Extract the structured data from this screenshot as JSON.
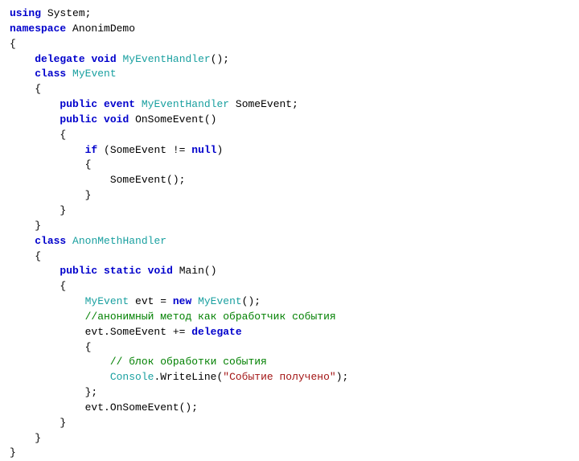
{
  "code": {
    "tokens": [
      [
        {
          "t": "using",
          "c": "kw"
        },
        {
          "t": " System;",
          "c": "p"
        }
      ],
      [
        {
          "t": "namespace",
          "c": "kw"
        },
        {
          "t": " AnonimDemo",
          "c": "p"
        }
      ],
      [
        {
          "t": "{",
          "c": "p"
        }
      ],
      [
        {
          "t": "    ",
          "c": "p"
        },
        {
          "t": "delegate",
          "c": "kw"
        },
        {
          "t": " ",
          "c": "p"
        },
        {
          "t": "void",
          "c": "kw"
        },
        {
          "t": " ",
          "c": "p"
        },
        {
          "t": "MyEventHandler",
          "c": "typ"
        },
        {
          "t": "();",
          "c": "p"
        }
      ],
      [
        {
          "t": "    ",
          "c": "p"
        },
        {
          "t": "class",
          "c": "kw"
        },
        {
          "t": " ",
          "c": "p"
        },
        {
          "t": "MyEvent",
          "c": "typ"
        }
      ],
      [
        {
          "t": "    {",
          "c": "p"
        }
      ],
      [
        {
          "t": "        ",
          "c": "p"
        },
        {
          "t": "public",
          "c": "kw"
        },
        {
          "t": " ",
          "c": "p"
        },
        {
          "t": "event",
          "c": "kw"
        },
        {
          "t": " ",
          "c": "p"
        },
        {
          "t": "MyEventHandler",
          "c": "typ"
        },
        {
          "t": " SomeEvent;",
          "c": "p"
        }
      ],
      [
        {
          "t": "        ",
          "c": "p"
        },
        {
          "t": "public",
          "c": "kw"
        },
        {
          "t": " ",
          "c": "p"
        },
        {
          "t": "void",
          "c": "kw"
        },
        {
          "t": " OnSomeEvent()",
          "c": "p"
        }
      ],
      [
        {
          "t": "        {",
          "c": "p"
        }
      ],
      [
        {
          "t": "            ",
          "c": "p"
        },
        {
          "t": "if",
          "c": "kw"
        },
        {
          "t": " (SomeEvent != ",
          "c": "p"
        },
        {
          "t": "null",
          "c": "kw"
        },
        {
          "t": ")",
          "c": "p"
        }
      ],
      [
        {
          "t": "            {",
          "c": "p"
        }
      ],
      [
        {
          "t": "                SomeEvent();",
          "c": "p"
        }
      ],
      [
        {
          "t": "            }",
          "c": "p"
        }
      ],
      [
        {
          "t": "        }",
          "c": "p"
        }
      ],
      [
        {
          "t": "    }",
          "c": "p"
        }
      ],
      [
        {
          "t": "    ",
          "c": "p"
        },
        {
          "t": "class",
          "c": "kw"
        },
        {
          "t": " ",
          "c": "p"
        },
        {
          "t": "AnonMethHandler",
          "c": "typ"
        }
      ],
      [
        {
          "t": "    {",
          "c": "p"
        }
      ],
      [
        {
          "t": "        ",
          "c": "p"
        },
        {
          "t": "public",
          "c": "kw"
        },
        {
          "t": " ",
          "c": "p"
        },
        {
          "t": "static",
          "c": "kw"
        },
        {
          "t": " ",
          "c": "p"
        },
        {
          "t": "void",
          "c": "kw"
        },
        {
          "t": " Main()",
          "c": "p"
        }
      ],
      [
        {
          "t": "        {",
          "c": "p"
        }
      ],
      [
        {
          "t": "            ",
          "c": "p"
        },
        {
          "t": "MyEvent",
          "c": "typ"
        },
        {
          "t": " evt = ",
          "c": "p"
        },
        {
          "t": "new",
          "c": "kw"
        },
        {
          "t": " ",
          "c": "p"
        },
        {
          "t": "MyEvent",
          "c": "typ"
        },
        {
          "t": "();",
          "c": "p"
        }
      ],
      [
        {
          "t": "            ",
          "c": "p"
        },
        {
          "t": "//анонимный метод как обработчик события",
          "c": "com"
        }
      ],
      [
        {
          "t": "            evt.SomeEvent += ",
          "c": "p"
        },
        {
          "t": "delegate",
          "c": "kw"
        }
      ],
      [
        {
          "t": "            {",
          "c": "p"
        }
      ],
      [
        {
          "t": "                ",
          "c": "p"
        },
        {
          "t": "// блок обработки события",
          "c": "com"
        }
      ],
      [
        {
          "t": "                ",
          "c": "p"
        },
        {
          "t": "Console",
          "c": "typ"
        },
        {
          "t": ".WriteLine(",
          "c": "p"
        },
        {
          "t": "\"Событие получено\"",
          "c": "str"
        },
        {
          "t": ");",
          "c": "p"
        }
      ],
      [
        {
          "t": "            };",
          "c": "p"
        }
      ],
      [
        {
          "t": "            evt.OnSomeEvent();",
          "c": "p"
        }
      ],
      [
        {
          "t": "        }",
          "c": "p"
        }
      ],
      [
        {
          "t": "    }",
          "c": "p"
        }
      ],
      [
        {
          "t": "}",
          "c": "p"
        }
      ]
    ]
  }
}
